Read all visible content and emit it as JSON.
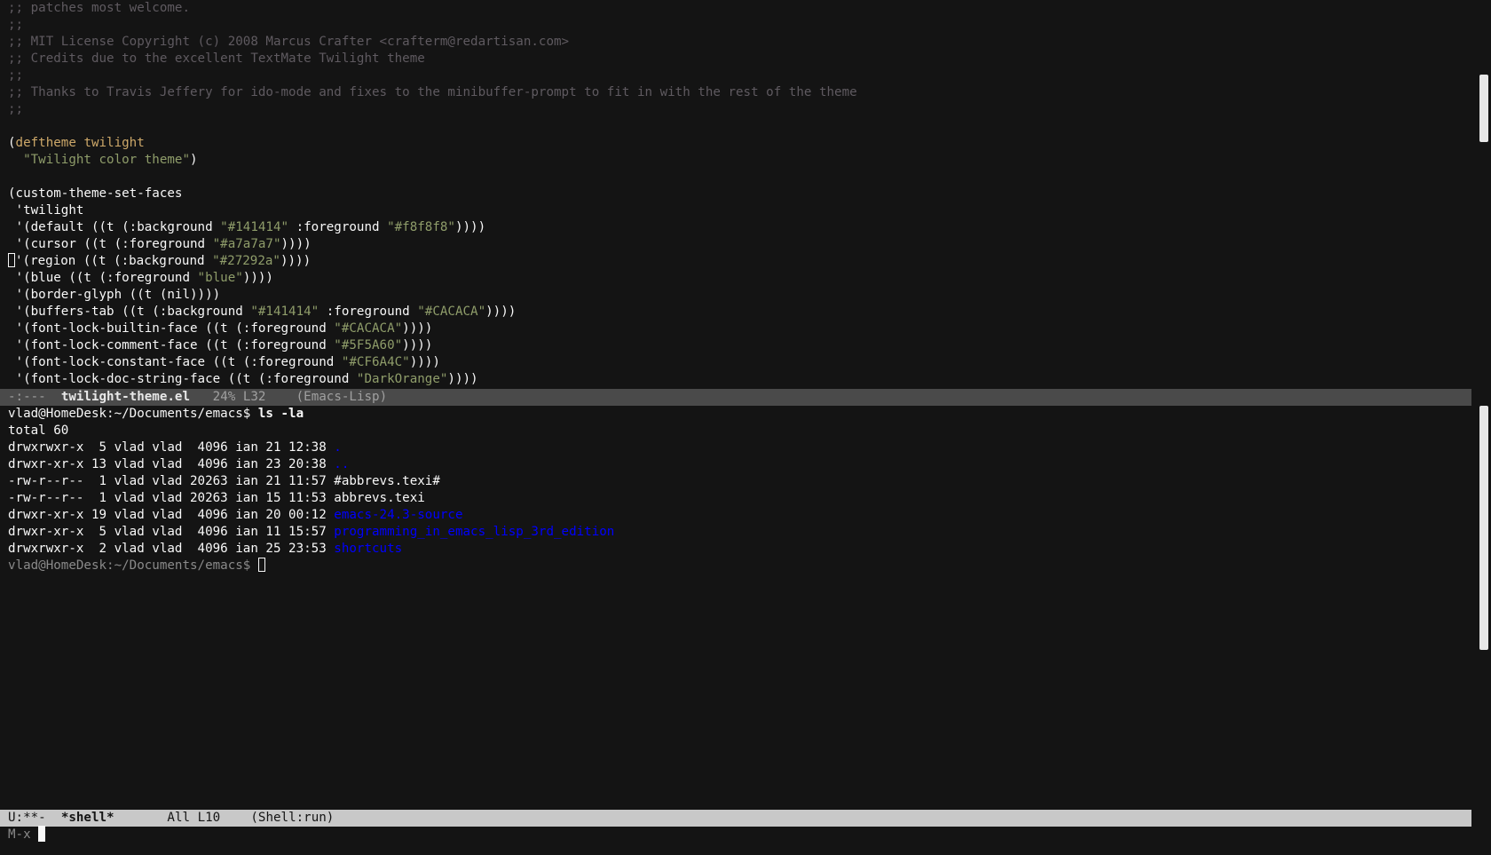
{
  "editor": {
    "comments": [
      ";; patches most welcome.",
      ";;",
      ";; MIT License Copyright (c) 2008 Marcus Crafter <crafterm@redartisan.com>",
      ";; Credits due to the excellent TextMate Twilight theme",
      ";;",
      ";; Thanks to Travis Jeffery for ido-mode and fixes to the minibuffer-prompt to fit in with the rest of the theme",
      ";;"
    ],
    "deftheme": {
      "open": "(",
      "keyword": "deftheme",
      "name": "twilight",
      "docstring": "\"Twilight color theme\"",
      "close": ")"
    },
    "set_faces_head": "(custom-theme-set-faces",
    "theme_symbol": " 'twilight",
    "faces": [
      {
        "pre": " '(default ((t (:background ",
        "s1": "\"#141414\"",
        "mid": " :foreground ",
        "s2": "\"#f8f8f8\"",
        "post": "))))"
      },
      {
        "pre": " '(cursor ((t (:foreground ",
        "s1": "\"#a7a7a7\"",
        "mid": "",
        "s2": "",
        "post": "))))"
      },
      {
        "pre": "'(region ((t (:background ",
        "s1": "\"#27292a\"",
        "mid": "",
        "s2": "",
        "post": "))))"
      },
      {
        "pre": " '(blue ((t (:foreground ",
        "s1": "\"blue\"",
        "mid": "",
        "s2": "",
        "post": "))))"
      },
      {
        "pre": " '(border-glyph ((t (nil))))",
        "s1": "",
        "mid": "",
        "s2": "",
        "post": ""
      },
      {
        "pre": " '(buffers-tab ((t (:background ",
        "s1": "\"#141414\"",
        "mid": " :foreground ",
        "s2": "\"#CACACA\"",
        "post": "))))"
      },
      {
        "pre": " '(font-lock-builtin-face ((t (:foreground ",
        "s1": "\"#CACACA\"",
        "mid": "",
        "s2": "",
        "post": "))))"
      },
      {
        "pre": " '(font-lock-comment-face ((t (:foreground ",
        "s1": "\"#5F5A60\"",
        "mid": "",
        "s2": "",
        "post": "))))"
      },
      {
        "pre": " '(font-lock-constant-face ((t (:foreground ",
        "s1": "\"#CF6A4C\"",
        "mid": "",
        "s2": "",
        "post": "))))"
      },
      {
        "pre": " '(font-lock-doc-string-face ((t (:foreground ",
        "s1": "\"DarkOrange\"",
        "mid": "",
        "s2": "",
        "post": "))))"
      }
    ]
  },
  "modeline_top": {
    "status": "-:---",
    "buffer": "twilight-theme.el",
    "position": "24% L32",
    "mode": "(Emacs-Lisp)"
  },
  "shell": {
    "prompt": "vlad@HomeDesk:~/Documents/emacs$",
    "command": "ls -la",
    "total": "total 60",
    "rows": [
      {
        "meta": "drwxrwxr-x  5 vlad vlad  4096 ian 21 12:38 ",
        "name": ".",
        "dir": true
      },
      {
        "meta": "drwxr-xr-x 13 vlad vlad  4096 ian 23 20:38 ",
        "name": "..",
        "dir": true
      },
      {
        "meta": "-rw-r--r--  1 vlad vlad 20263 ian 21 11:57 ",
        "name": "#abbrevs.texi#",
        "dir": false
      },
      {
        "meta": "-rw-r--r--  1 vlad vlad 20263 ian 15 11:53 ",
        "name": "abbrevs.texi",
        "dir": false
      },
      {
        "meta": "drwxr-xr-x 19 vlad vlad  4096 ian 20 00:12 ",
        "name": "emacs-24.3-source",
        "dir": true
      },
      {
        "meta": "drwxr-xr-x  5 vlad vlad  4096 ian 11 15:57 ",
        "name": "programming_in_emacs_lisp_3rd_edition",
        "dir": true
      },
      {
        "meta": "drwxrwxr-x  2 vlad vlad  4096 ian 25 23:53 ",
        "name": "shortcuts",
        "dir": true
      }
    ],
    "final_prompt": "vlad@HomeDesk:~/Documents/emacs$ "
  },
  "modeline_bottom": {
    "status": "U:**-",
    "buffer": "*shell*",
    "position": "All L10",
    "mode": "(Shell:run)"
  },
  "minibuffer": {
    "prompt": "M-x "
  },
  "colors": {
    "background": "#141414",
    "foreground": "#f8f8f8",
    "comment": "#5F5A60",
    "keyword": "#CDA869",
    "string": "#8F9D6A",
    "directory": "#0000ff"
  }
}
